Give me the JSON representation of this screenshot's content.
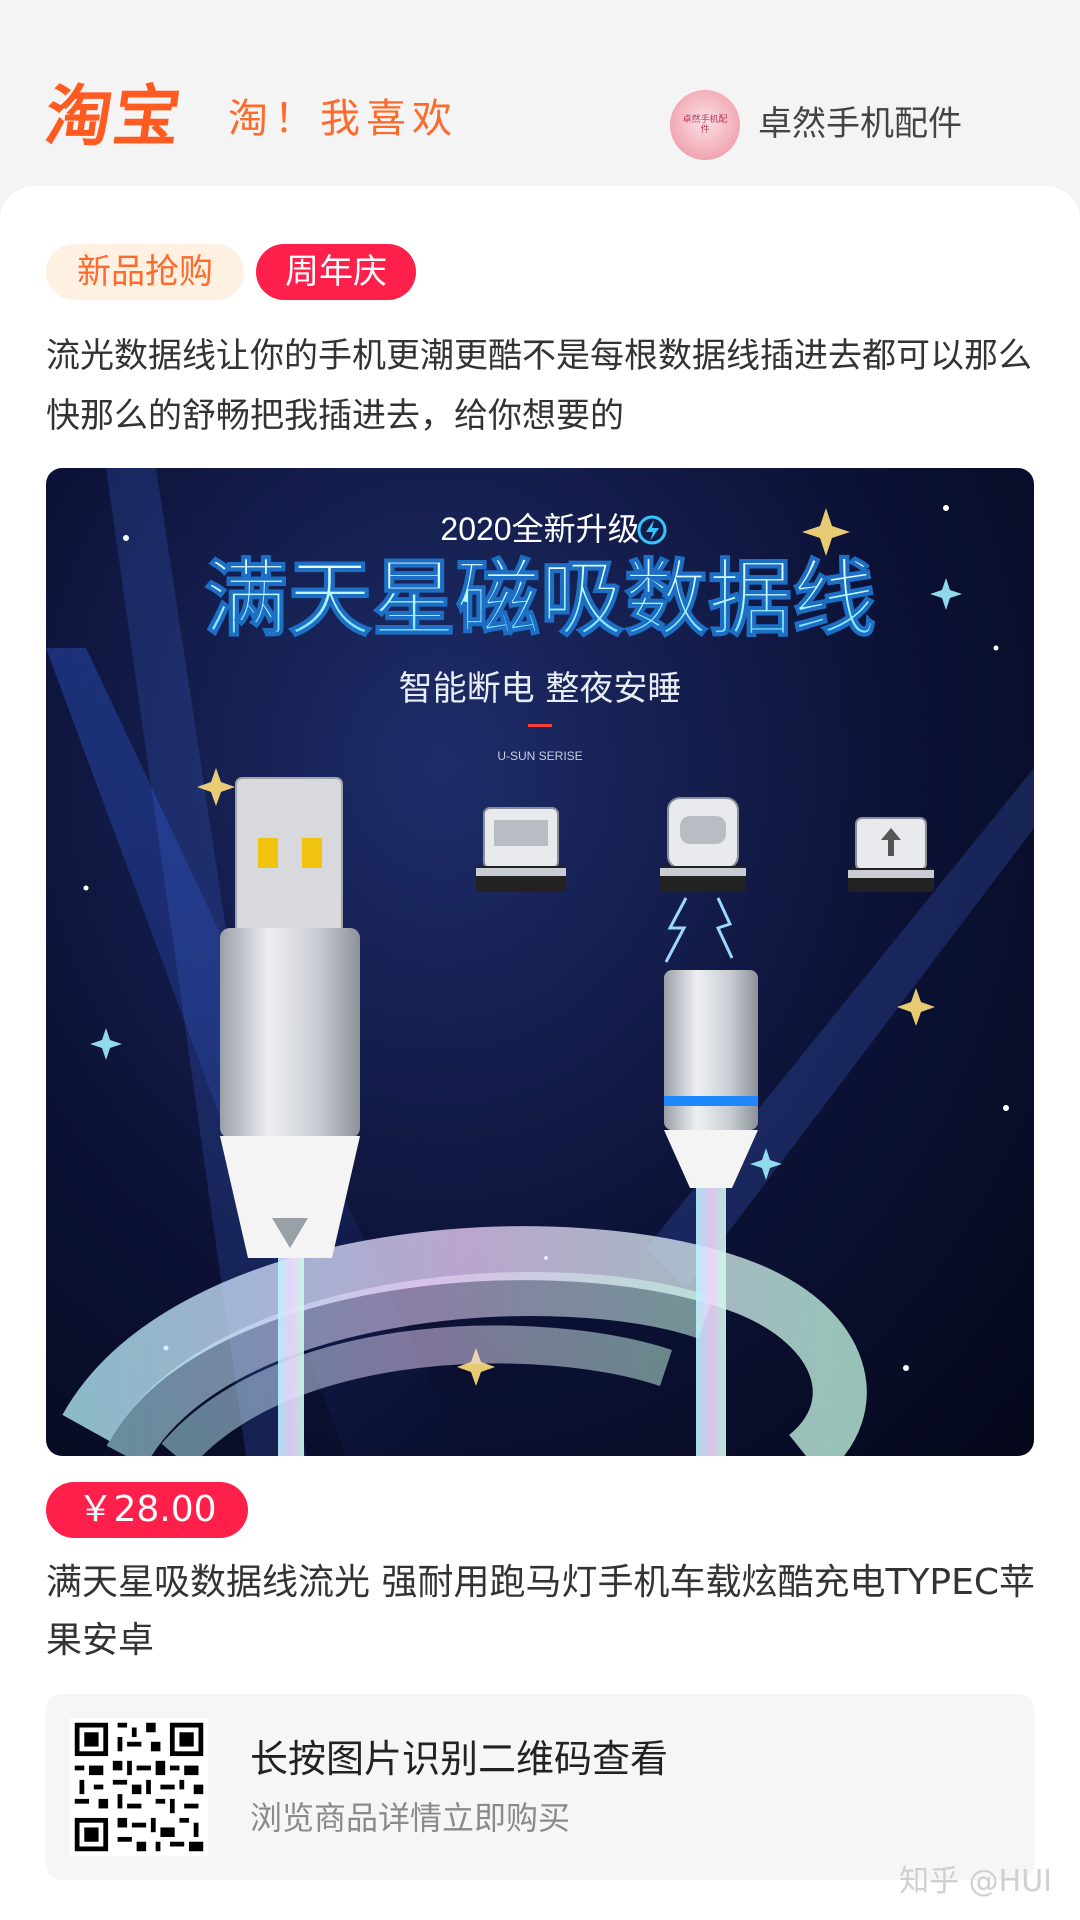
{
  "header": {
    "logo": "淘宝",
    "slogan": "淘！我喜欢",
    "store_avatar_text": "卓然手机配件",
    "store_name": "卓然手机配件"
  },
  "tags": [
    "新品抢购",
    "周年庆"
  ],
  "description": "流光数据线让你的手机更潮更酷不是每根数据线插进去都可以那么快那么的舒畅把我插进去，给你想要的",
  "product_image": {
    "top_text": "2020全新升级",
    "headline": "满天星磁吸数据线",
    "subline": "智能断电 整夜安睡",
    "series": "U-SUN SERISE"
  },
  "price": "￥28.00",
  "product_title": "满天星吸数据线流光 强耐用跑马灯手机车载炫酷充电TYPEC苹果安卓",
  "qr": {
    "title": "长按图片识别二维码查看",
    "subtitle": "浏览商品详情立即购买"
  },
  "watermark": "知乎 @HUI",
  "colors": {
    "brand_orange": "#ff5a1f",
    "tag_red": "#ff1f4b"
  }
}
